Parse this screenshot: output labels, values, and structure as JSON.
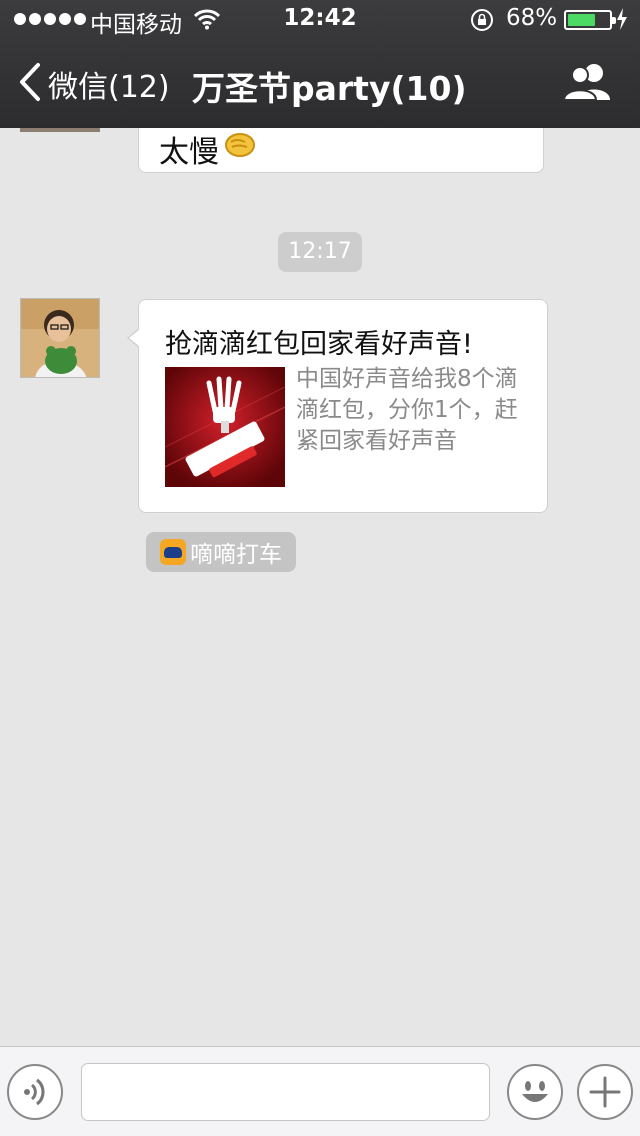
{
  "status_bar": {
    "carrier": "中国移动",
    "time": "12:42",
    "battery_percent": "68%",
    "battery_level": 0.68,
    "battery_color": "#4cd964"
  },
  "nav": {
    "back_label": "微信(12)",
    "title": "万圣节party(10)",
    "back_icon": "chevron-left-icon",
    "members_icon": "group-icon"
  },
  "chat": {
    "previous_message": {
      "text": "太慢",
      "emoji": "hand-emoji"
    },
    "timestamp": "12:17",
    "message": {
      "title": "抢滴滴红包回家看好声音!",
      "description": "中国好声音给我8个滴滴红包，分你1个，赶紧回家看好声音",
      "thumbnail": "voice-of-china-logo"
    },
    "source_app": "嘀嘀打车"
  },
  "input_bar": {
    "voice_icon": "voice-icon",
    "emoji_icon": "smiley-icon",
    "plus_icon": "plus-icon",
    "text_value": ""
  }
}
